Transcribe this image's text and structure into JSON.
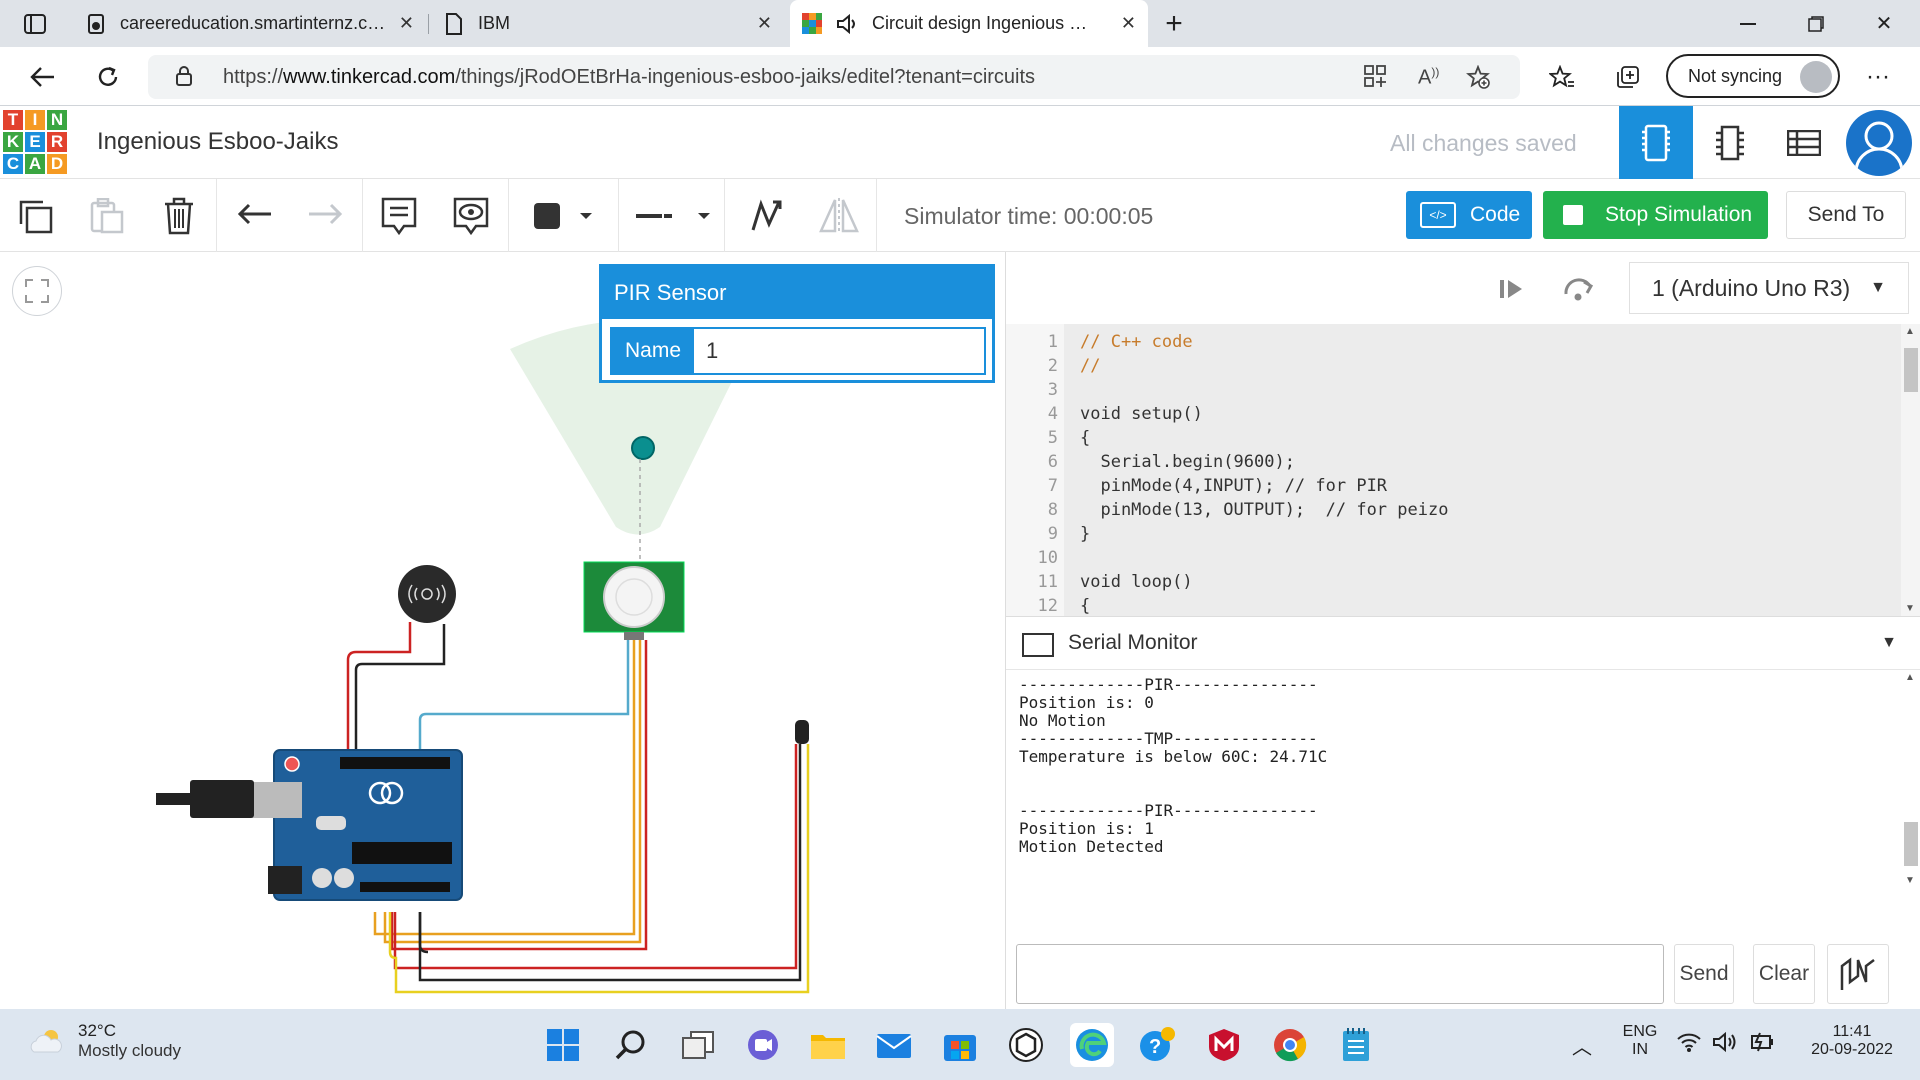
{
  "browser": {
    "tabs": [
      {
        "title": "careereducation.smartinternz.com",
        "icon": "page-icon"
      },
      {
        "title": "IBM",
        "icon": "document-icon"
      },
      {
        "title": "Circuit design Ingenious Esboo-Jaiks",
        "icon": "tinkercad-icon"
      }
    ],
    "url_prefix": "https://",
    "url_host": "www.tinkercad.com",
    "url_path": "/things/jRodOEtBrHa-ingenious-esboo-jaiks/editel?tenant=circuits",
    "sync_label": "Not syncing"
  },
  "tinkercad": {
    "logo_letters": [
      "T",
      "I",
      "N",
      "K",
      "E",
      "R",
      "C",
      "A",
      "D"
    ],
    "logo_colors": [
      "#e2422e",
      "#f59a23",
      "#3aa641",
      "#3aa641",
      "#1a8fdb",
      "#e2422e",
      "#1a8fdb",
      "#3aa641",
      "#f59a23"
    ],
    "project_title": "Ingenious Esboo-Jaiks",
    "save_status": "All changes saved",
    "accent_color": "#1a8fdb"
  },
  "toolbar": {
    "simulator_time": "Simulator time: 00:00:05",
    "code_label": "Code",
    "stop_label": "Stop Simulation",
    "send_to_label": "Send To"
  },
  "inspector": {
    "title": "PIR Sensor",
    "name_label": "Name",
    "name_value": "1"
  },
  "code_panel": {
    "board": "1 (Arduino Uno R3)",
    "line_numbers": [
      "1",
      "2",
      "3",
      "4",
      "5",
      "6",
      "7",
      "8",
      "9",
      "10",
      "11",
      "12"
    ],
    "code_lines": [
      "// C++ code",
      "//",
      "",
      "void setup()",
      "{",
      "  Serial.begin(9600);",
      "  pinMode(4,INPUT); // for PIR",
      "  pinMode(13, OUTPUT);  // for peizo",
      "}",
      "",
      "void loop()",
      "{"
    ],
    "serial_monitor_label": "Serial Monitor",
    "serial_lines": [
      "-------------PIR---------------",
      "Position is: 0",
      "No Motion",
      "-------------TMP---------------",
      "Temperature is below 60C: 24.71C",
      "",
      "",
      "-------------PIR---------------",
      "Position is: 1",
      "Motion Detected"
    ],
    "send_label": "Send",
    "clear_label": "Clear"
  },
  "taskbar": {
    "temperature": "32°C",
    "weather": "Mostly cloudy",
    "lang1": "ENG",
    "lang2": "IN",
    "time": "11:41",
    "date": "20-09-2022"
  }
}
